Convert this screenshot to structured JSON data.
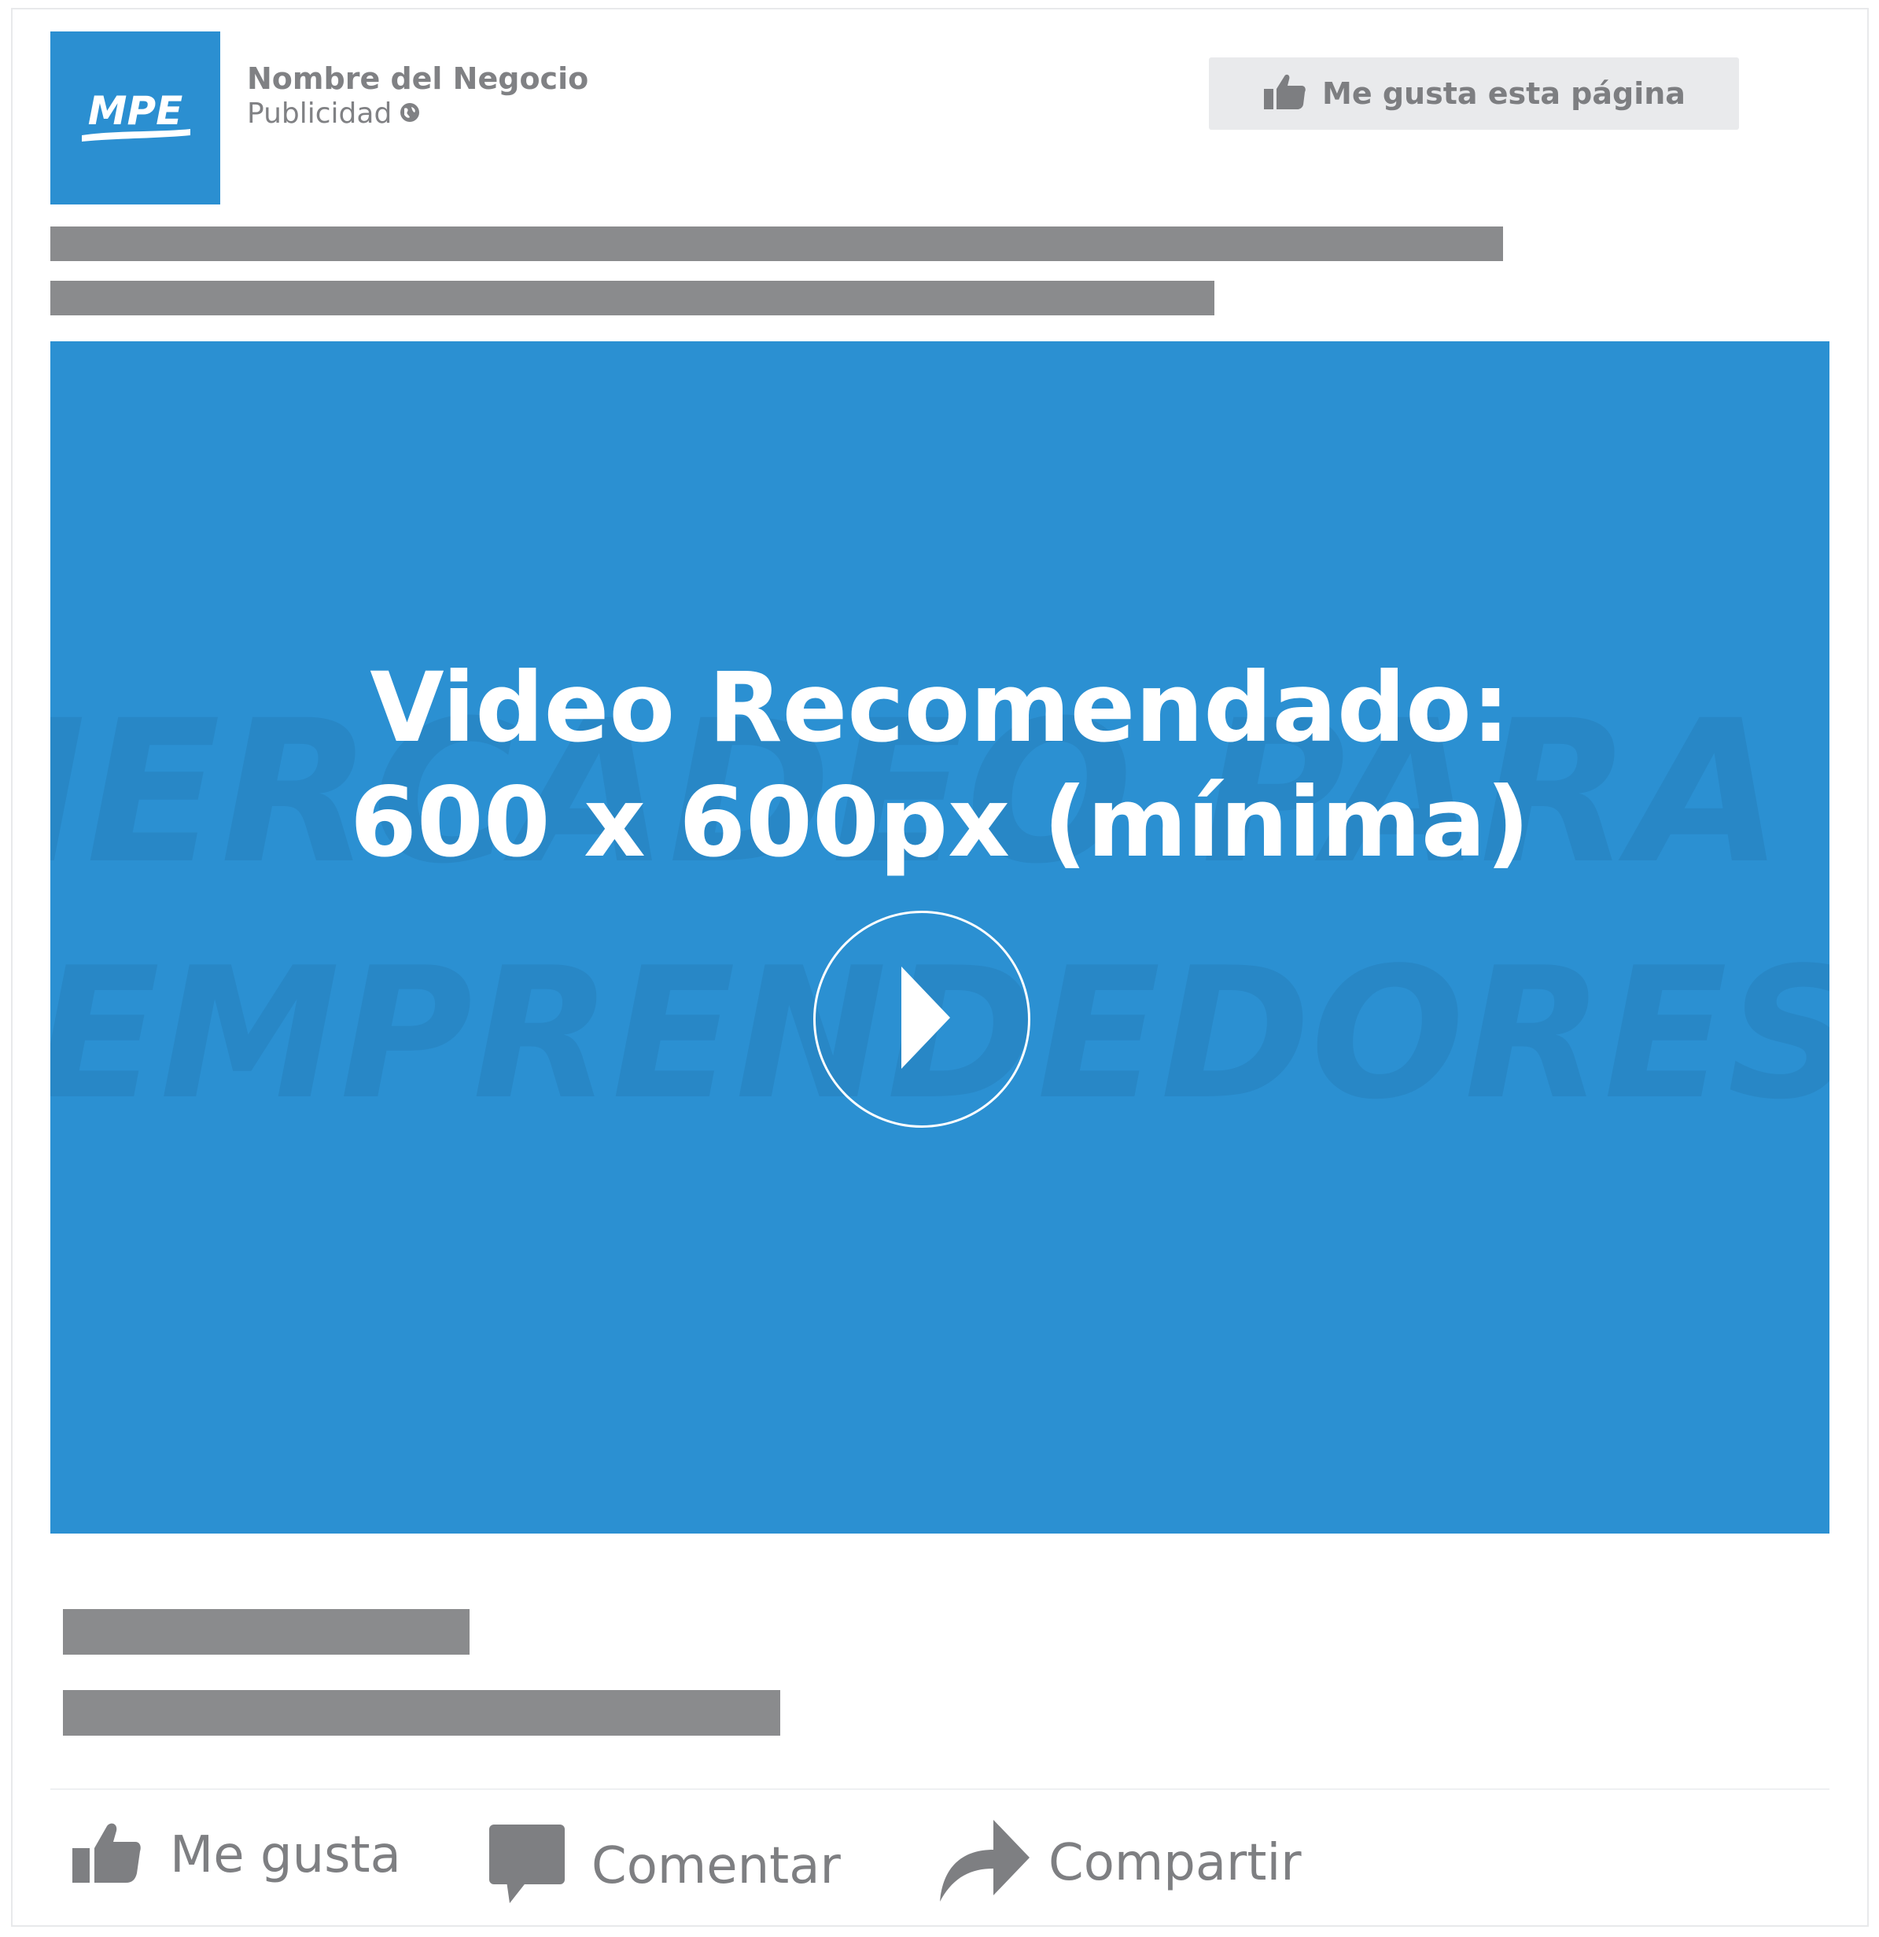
{
  "post": {
    "page_name": "Nombre del Negocio",
    "sponsored_label": "Publicidad",
    "sponsored_icon": "globe-icon",
    "logo_text": "MPE",
    "like_page_button": {
      "label": "Me gusta esta página",
      "icon": "thumbs-up-icon"
    }
  },
  "video": {
    "title_line1": "Video Recomendado:",
    "title_line2": "600 x 600px (mínima)",
    "watermark_line1": "MERCADEO PARA",
    "watermark_line2": "EMPRENDEDORES",
    "play_icon": "play-icon"
  },
  "actions": [
    {
      "label": "Me gusta",
      "icon": "thumbs-up-icon"
    },
    {
      "label": "Comentar",
      "icon": "comment-icon"
    },
    {
      "label": "Compartir",
      "icon": "share-icon"
    }
  ],
  "colors": {
    "brand_blue": "#2b90d2",
    "placeholder_gray": "#8a8b8d",
    "text_gray": "#808184",
    "button_bg": "#e9eaec"
  }
}
